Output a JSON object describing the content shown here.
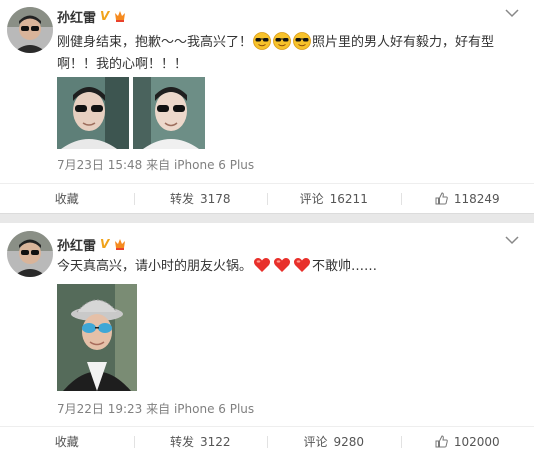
{
  "posts": [
    {
      "author": "孙红雷",
      "verified_mark": "V",
      "text_part1": "刚健身结束，抱歉～～我高兴了！",
      "text_part2": "照片里的男人好有毅力，好有型啊！！我的心啊！！！",
      "emoji": "sunglasses-emoji",
      "time": "7月23日 15:48",
      "source": "来自 iPhone 6 Plus",
      "actions": {
        "favorite_label": "收藏",
        "repost_label": "转发",
        "repost_count": "3178",
        "comment_label": "评论",
        "comment_count": "16211",
        "like_count": "118249"
      }
    },
    {
      "author": "孙红雷",
      "verified_mark": "V",
      "text_part1": "今天真高兴，请小时的朋友火锅。",
      "text_part2": "不敢帅……",
      "emoji": "heart-emoji",
      "time": "7月22日 19:23",
      "source": "来自 iPhone 6 Plus",
      "actions": {
        "favorite_label": "收藏",
        "repost_label": "转发",
        "repost_count": "3122",
        "comment_label": "评论",
        "comment_count": "9280",
        "like_count": "102000"
      }
    }
  ],
  "colors": {
    "verified": "#f0a31b",
    "text": "#333333",
    "meta": "#808080",
    "divider": "#e8e8e8"
  }
}
